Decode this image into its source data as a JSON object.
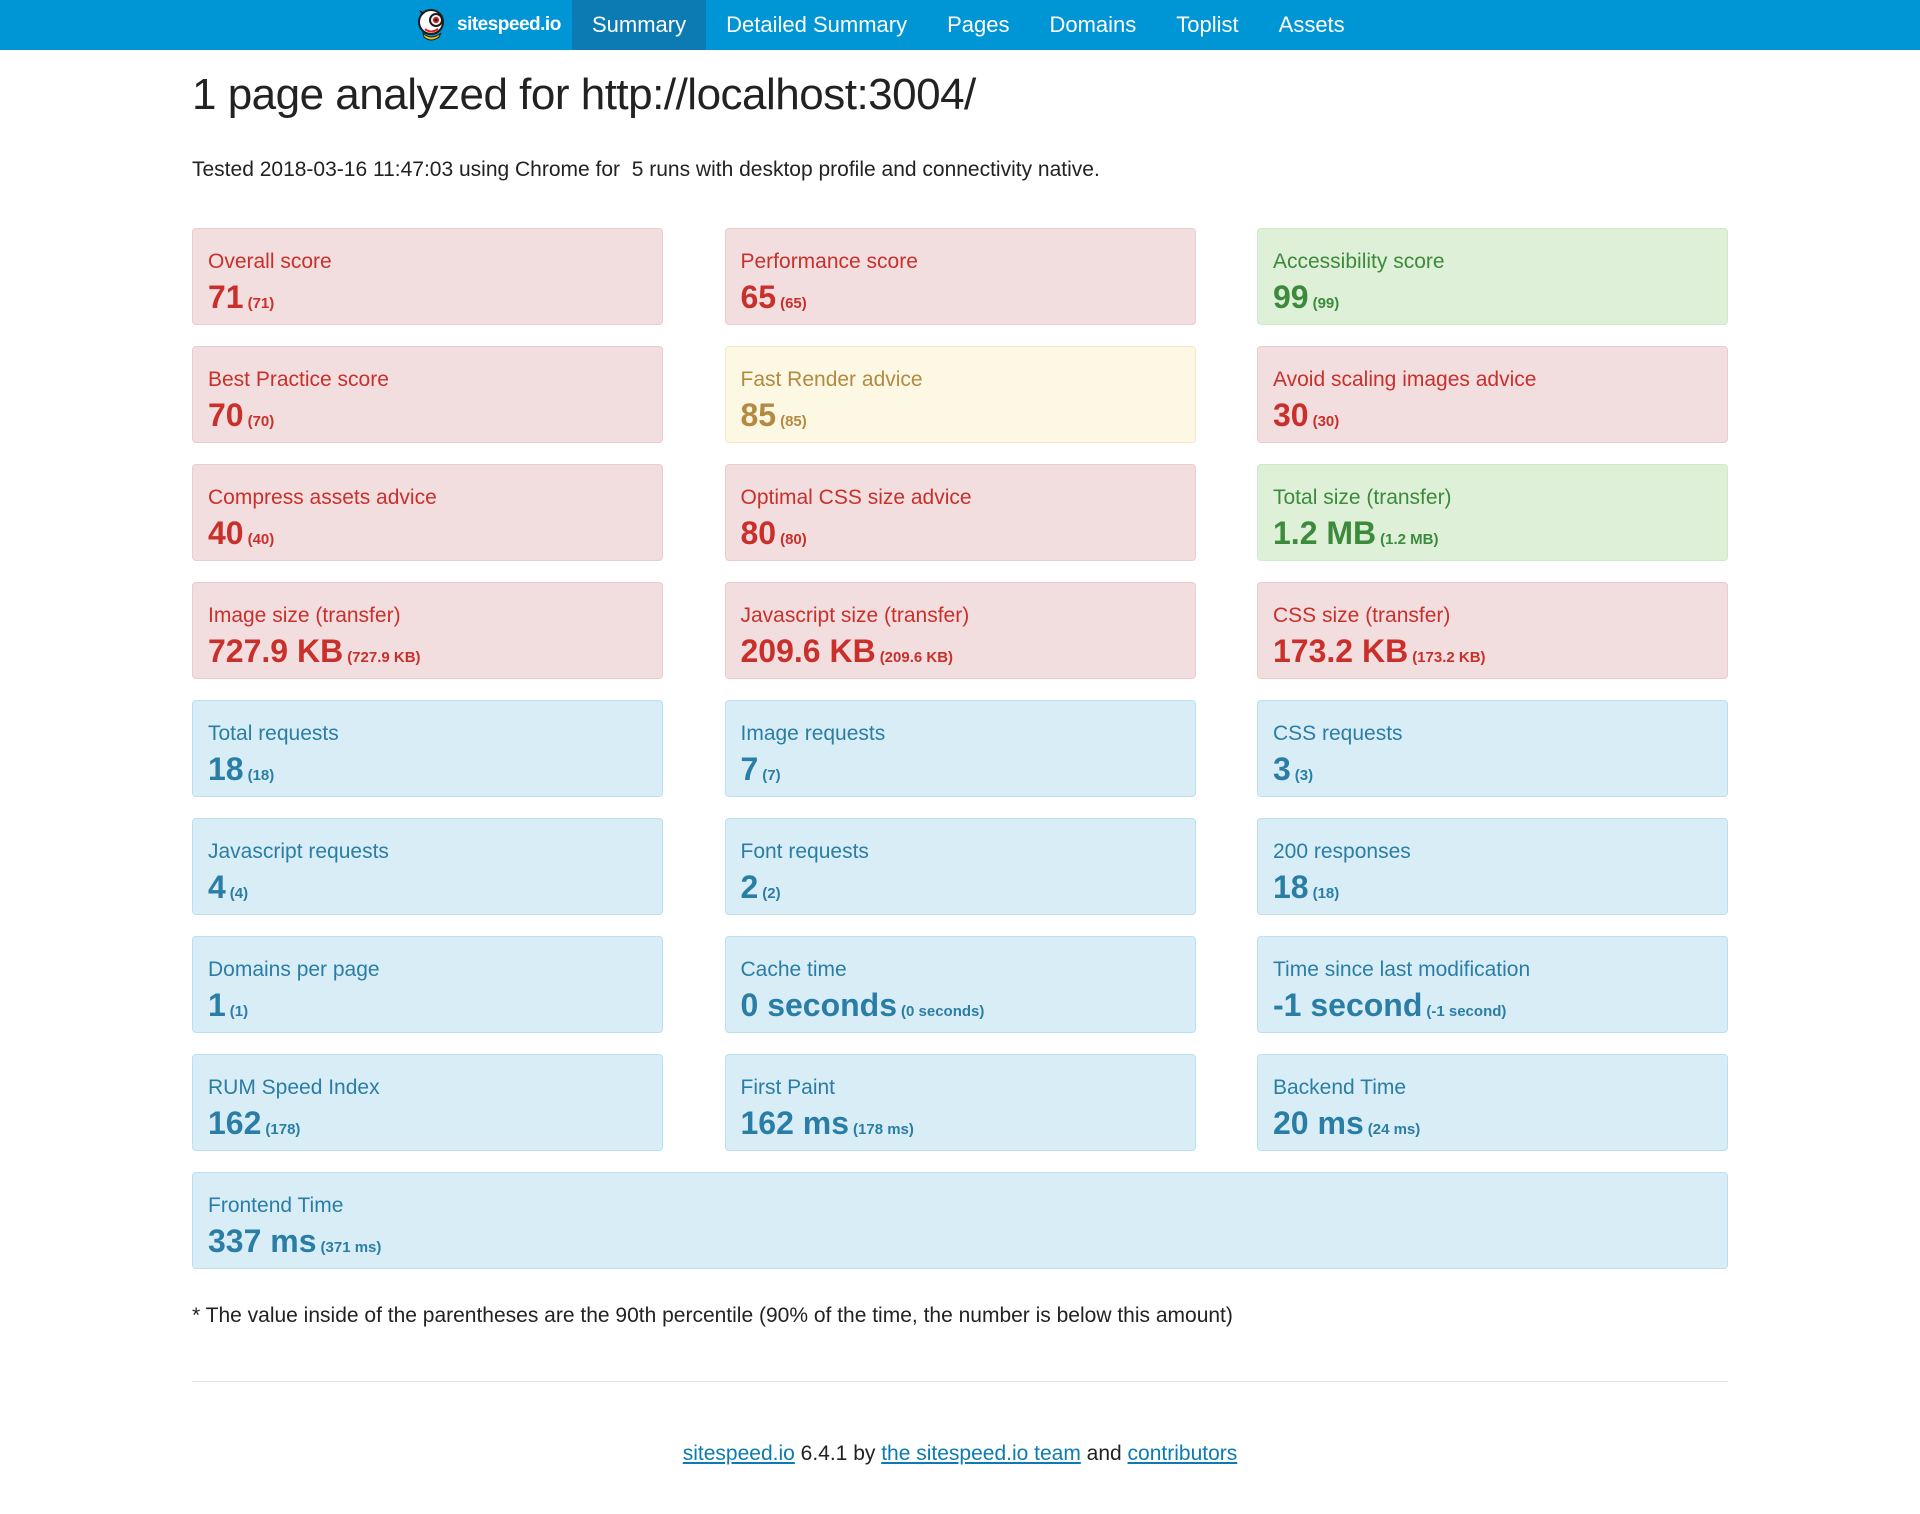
{
  "nav": {
    "brand": "sitespeed.io",
    "items": [
      "Summary",
      "Detailed Summary",
      "Pages",
      "Domains",
      "Toplist",
      "Assets"
    ],
    "active": "Summary",
    "bar_color": "#0095d5",
    "active_color": "#0c7bb3"
  },
  "page": {
    "title": "1 page analyzed for http://localhost:3004/",
    "tested_line": "Tested 2018-03-16 11:47:03 using Chrome for  5 runs with desktop profile and connectivity native."
  },
  "status_colors": {
    "danger": "#c9302c",
    "warning": "#b38a3f",
    "success": "#3c8a3c",
    "info": "#2a7ea6"
  },
  "cards": [
    {
      "label": "Overall score",
      "value": "71",
      "p90": "(71)",
      "status": "danger"
    },
    {
      "label": "Performance score",
      "value": "65",
      "p90": "(65)",
      "status": "danger"
    },
    {
      "label": "Accessibility score",
      "value": "99",
      "p90": "(99)",
      "status": "success"
    },
    {
      "label": "Best Practice score",
      "value": "70",
      "p90": "(70)",
      "status": "danger"
    },
    {
      "label": "Fast Render advice",
      "value": "85",
      "p90": "(85)",
      "status": "warning"
    },
    {
      "label": "Avoid scaling images advice",
      "value": "30",
      "p90": "(30)",
      "status": "danger"
    },
    {
      "label": "Compress assets advice",
      "value": "40",
      "p90": "(40)",
      "status": "danger"
    },
    {
      "label": "Optimal CSS size advice",
      "value": "80",
      "p90": "(80)",
      "status": "danger"
    },
    {
      "label": "Total size (transfer)",
      "value": "1.2 MB",
      "p90": "(1.2 MB)",
      "status": "success"
    },
    {
      "label": "Image size (transfer)",
      "value": "727.9 KB",
      "p90": "(727.9 KB)",
      "status": "danger"
    },
    {
      "label": "Javascript size (transfer)",
      "value": "209.6 KB",
      "p90": "(209.6 KB)",
      "status": "danger"
    },
    {
      "label": "CSS size (transfer)",
      "value": "173.2 KB",
      "p90": "(173.2 KB)",
      "status": "danger"
    },
    {
      "label": "Total requests",
      "value": "18",
      "p90": "(18)",
      "status": "info"
    },
    {
      "label": "Image requests",
      "value": "7",
      "p90": "(7)",
      "status": "info"
    },
    {
      "label": "CSS requests",
      "value": "3",
      "p90": "(3)",
      "status": "info"
    },
    {
      "label": "Javascript requests",
      "value": "4",
      "p90": "(4)",
      "status": "info"
    },
    {
      "label": "Font requests",
      "value": "2",
      "p90": "(2)",
      "status": "info"
    },
    {
      "label": "200 responses",
      "value": "18",
      "p90": "(18)",
      "status": "info"
    },
    {
      "label": "Domains per page",
      "value": "1",
      "p90": "(1)",
      "status": "info"
    },
    {
      "label": "Cache time",
      "value": "0 seconds",
      "p90": "(0 seconds)",
      "status": "info"
    },
    {
      "label": "Time since last modification",
      "value": "-1 second",
      "p90": "(-1 second)",
      "status": "info"
    },
    {
      "label": "RUM Speed Index",
      "value": "162",
      "p90": "(178)",
      "status": "info"
    },
    {
      "label": "First Paint",
      "value": "162 ms",
      "p90": "(178 ms)",
      "status": "info"
    },
    {
      "label": "Backend Time",
      "value": "20 ms",
      "p90": "(24 ms)",
      "status": "info"
    },
    {
      "label": "Frontend Time",
      "value": "337 ms",
      "p90": "(371 ms)",
      "status": "info",
      "full": true
    }
  ],
  "footnote": "* The value inside of the parentheses are the 90th percentile (90% of the time, the number is below this amount)",
  "footer": {
    "link1": "sitespeed.io",
    "version": " 6.4.1 by ",
    "link2": "the sitespeed.io team",
    "and": " and ",
    "link3": "contributors"
  }
}
